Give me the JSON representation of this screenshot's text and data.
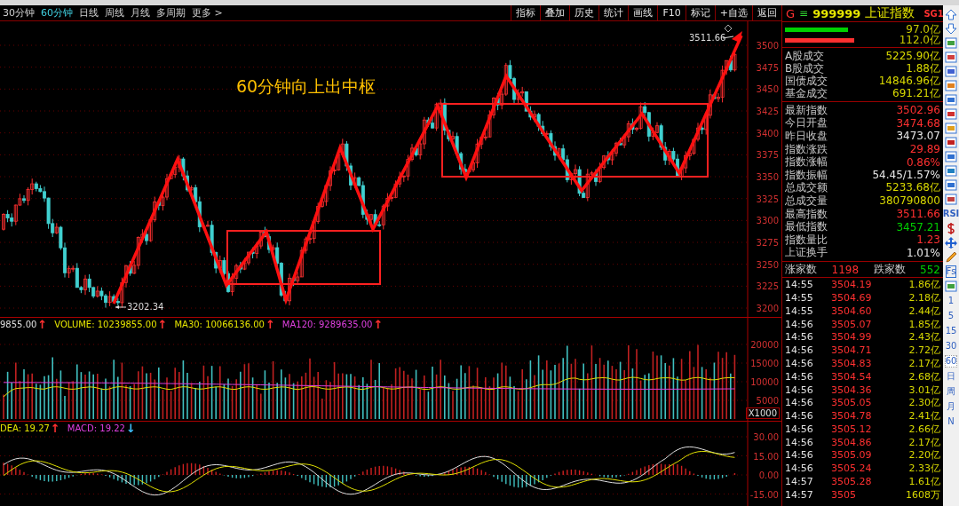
{
  "toolbar": {
    "periods": [
      {
        "label": "30分钟",
        "selected": false
      },
      {
        "label": "60分钟",
        "selected": true
      },
      {
        "label": "日线",
        "selected": false
      },
      {
        "label": "周线",
        "selected": false
      },
      {
        "label": "月线",
        "selected": false
      },
      {
        "label": "多周期",
        "selected": false
      },
      {
        "label": "更多 >",
        "selected": false
      }
    ],
    "buttons": [
      "指标",
      "叠加",
      "历史",
      "统计",
      "画线",
      "F10",
      "标记",
      "+自选",
      "返回"
    ]
  },
  "price_chart": {
    "annotation": "60分钟向上出中枢",
    "low_label": "3202.34",
    "high_label": "3511.66",
    "axis": [
      "3500",
      "3475",
      "3450",
      "3425",
      "3400",
      "3375",
      "3350",
      "3325",
      "3300",
      "3275",
      "3250",
      "3225",
      "3200"
    ]
  },
  "volume_chart": {
    "legend": [
      {
        "text": "9855.00",
        "color": "#e0e0e0",
        "arrow": {
          "text": "↑",
          "color": "#ff3030"
        }
      },
      {
        "text": "VOLUME: 10239855.00",
        "color": "#e6e600",
        "arrow": {
          "text": "↑",
          "color": "#ff3030"
        }
      },
      {
        "text": "MA30: 10066136.00",
        "color": "#e6e600",
        "arrow": {
          "text": "↑",
          "color": "#ff3030"
        }
      },
      {
        "text": "MA120: 9289635.00",
        "color": "#e040e0",
        "arrow": {
          "text": "↑",
          "color": "#ff3030"
        }
      }
    ],
    "axis": [
      "20000",
      "15000",
      "10000",
      "5000"
    ],
    "unit": "X1000"
  },
  "macd_chart": {
    "legend": [
      {
        "text": "DEA: 19.27",
        "color": "#e6e600",
        "arrow": {
          "text": "↑",
          "color": "#ff3030"
        }
      },
      {
        "text": "MACD: 19.22",
        "color": "#e040e0",
        "arrow": {
          "text": "↓",
          "color": "#40c0ff"
        }
      }
    ],
    "axis": [
      "30.00",
      "15.00",
      "0.00",
      "-15.00"
    ]
  },
  "quote": {
    "marker": "G",
    "menu": "≡",
    "code": "999999",
    "name": "上证指数",
    "badge": "SG1"
  },
  "flow": [
    {
      "value": "97.0亿",
      "level": 0.6,
      "color": "#00d000"
    },
    {
      "value": "112.0亿",
      "level": 0.66,
      "color": "#ff3030"
    }
  ],
  "turnover": [
    {
      "label": "A股成交",
      "value": "5225.90亿"
    },
    {
      "label": "B股成交",
      "value": "1.88亿"
    },
    {
      "label": "国债成交",
      "value": "14846.96亿"
    },
    {
      "label": "基金成交",
      "value": "691.21亿"
    }
  ],
  "stats": [
    {
      "label": "最新指数",
      "value": "3502.96",
      "color": "#ff3030"
    },
    {
      "label": "今日开盘",
      "value": "3474.68",
      "color": "#ff3030"
    },
    {
      "label": "昨日收盘",
      "value": "3473.07",
      "color": "#e8e8e8"
    },
    {
      "label": "指数涨跌",
      "value": "29.89",
      "color": "#ff3030"
    },
    {
      "label": "指数涨幅",
      "value": "0.86%",
      "color": "#ff3030"
    },
    {
      "label": "指数振幅",
      "value": "54.45/1.57%",
      "color": "#e8e8e8"
    },
    {
      "label": "总成交额",
      "value": "5233.68亿",
      "color": "#d8d800"
    },
    {
      "label": "总成交量",
      "value": "380790800",
      "color": "#d8d800"
    },
    {
      "label": "最高指数",
      "value": "3511.66",
      "color": "#ff3030"
    },
    {
      "label": "最低指数",
      "value": "3457.21",
      "color": "#00d000"
    },
    {
      "label": "指数量比",
      "value": "1.23",
      "color": "#ff3030"
    },
    {
      "label": "上证换手",
      "value": "1.01%",
      "color": "#e8e8e8"
    }
  ],
  "breadth": {
    "up_label": "涨家数",
    "up": "1198",
    "down_label": "跌家数",
    "down": "552"
  },
  "ticks": [
    {
      "time": "14:55",
      "price": "3504.19",
      "volume": "1.86亿"
    },
    {
      "time": "14:55",
      "price": "3504.69",
      "volume": "2.18亿"
    },
    {
      "time": "14:55",
      "price": "3504.60",
      "volume": "2.44亿"
    },
    {
      "time": "14:56",
      "price": "3505.07",
      "volume": "1.85亿"
    },
    {
      "time": "14:56",
      "price": "3504.99",
      "volume": "2.43亿"
    },
    {
      "time": "14:56",
      "price": "3504.71",
      "volume": "2.72亿"
    },
    {
      "time": "14:56",
      "price": "3504.83",
      "volume": "2.17亿"
    },
    {
      "time": "14:56",
      "price": "3504.54",
      "volume": "2.68亿"
    },
    {
      "time": "14:56",
      "price": "3504.36",
      "volume": "3.01亿"
    },
    {
      "time": "14:56",
      "price": "3505.05",
      "volume": "2.30亿"
    },
    {
      "time": "14:56",
      "price": "3504.78",
      "volume": "2.41亿"
    },
    {
      "time": "14:56",
      "price": "3505.12",
      "volume": "2.66亿"
    },
    {
      "time": "14:56",
      "price": "3504.86",
      "volume": "2.17亿"
    },
    {
      "time": "14:56",
      "price": "3505.09",
      "volume": "2.20亿"
    },
    {
      "time": "14:56",
      "price": "3505.24",
      "volume": "2.33亿"
    },
    {
      "time": "14:57",
      "price": "3505.28",
      "volume": "1.61亿"
    },
    {
      "time": "14:57",
      "price": "3505",
      "volume": "1608万"
    }
  ],
  "side_text_tools": [
    "RSI",
    "Fs"
  ],
  "side_periods": [
    {
      "label": "1",
      "selected": false
    },
    {
      "label": "5",
      "selected": false
    },
    {
      "label": "15",
      "selected": false
    },
    {
      "label": "30",
      "selected": false
    },
    {
      "label": "60",
      "selected": true
    },
    {
      "label": "日",
      "selected": false
    },
    {
      "label": "周",
      "selected": false
    },
    {
      "label": "月",
      "selected": false
    },
    {
      "label": "N",
      "selected": false
    }
  ]
}
